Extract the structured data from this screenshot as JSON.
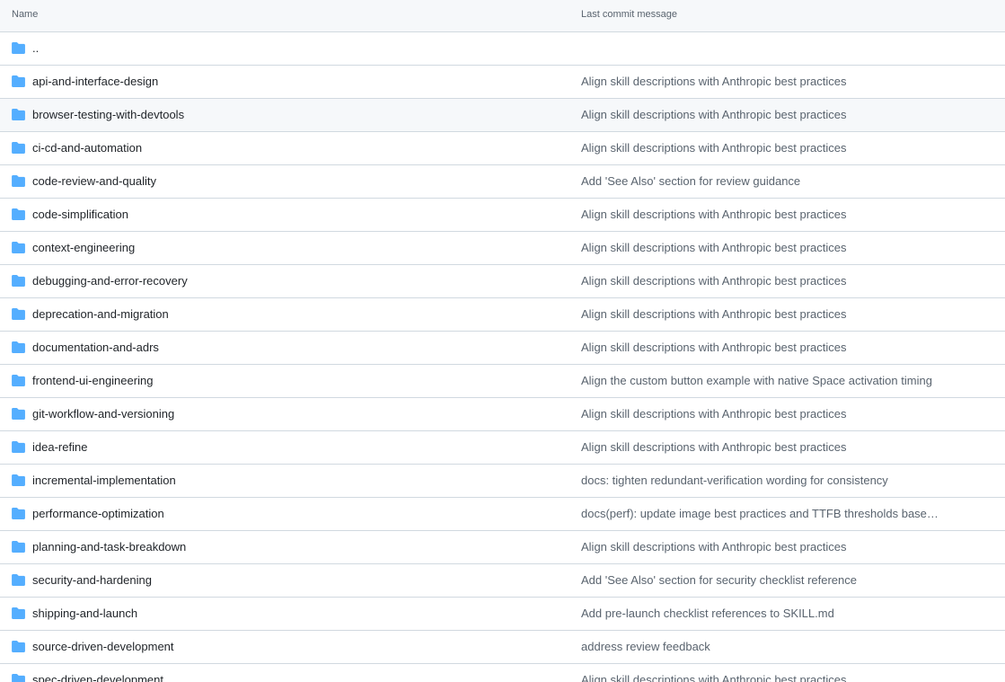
{
  "header": {
    "name_label": "Name",
    "message_label": "Last commit message"
  },
  "folder_color": "#54aeff",
  "rows": [
    {
      "name": "..",
      "message": ""
    },
    {
      "name": "api-and-interface-design",
      "message": "Align skill descriptions with Anthropic best practices"
    },
    {
      "name": "browser-testing-with-devtools",
      "message": "Align skill descriptions with Anthropic best practices"
    },
    {
      "name": "ci-cd-and-automation",
      "message": "Align skill descriptions with Anthropic best practices"
    },
    {
      "name": "code-review-and-quality",
      "message": "Add 'See Also' section for review guidance"
    },
    {
      "name": "code-simplification",
      "message": "Align skill descriptions with Anthropic best practices"
    },
    {
      "name": "context-engineering",
      "message": "Align skill descriptions with Anthropic best practices"
    },
    {
      "name": "debugging-and-error-recovery",
      "message": "Align skill descriptions with Anthropic best practices"
    },
    {
      "name": "deprecation-and-migration",
      "message": "Align skill descriptions with Anthropic best practices"
    },
    {
      "name": "documentation-and-adrs",
      "message": "Align skill descriptions with Anthropic best practices"
    },
    {
      "name": "frontend-ui-engineering",
      "message": "Align the custom button example with native Space activation timing"
    },
    {
      "name": "git-workflow-and-versioning",
      "message": "Align skill descriptions with Anthropic best practices"
    },
    {
      "name": "idea-refine",
      "message": "Align skill descriptions with Anthropic best practices"
    },
    {
      "name": "incremental-implementation",
      "message": "docs: tighten redundant-verification wording for consistency"
    },
    {
      "name": "performance-optimization",
      "message": "docs(perf): update image best practices and TTFB thresholds based on ..."
    },
    {
      "name": "planning-and-task-breakdown",
      "message": "Align skill descriptions with Anthropic best practices"
    },
    {
      "name": "security-and-hardening",
      "message": "Add 'See Also' section for security checklist reference"
    },
    {
      "name": "shipping-and-launch",
      "message": "Add pre-launch checklist references to SKILL.md"
    },
    {
      "name": "source-driven-development",
      "message": "address review feedback"
    },
    {
      "name": "spec-driven-development",
      "message": "Align skill descriptions with Anthropic best practices"
    }
  ]
}
